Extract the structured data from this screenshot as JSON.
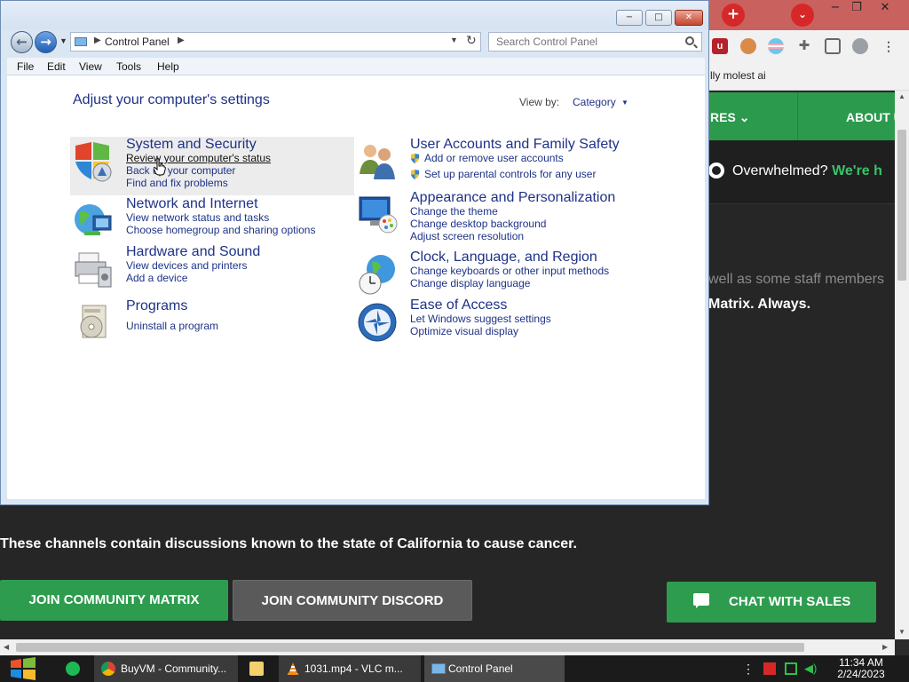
{
  "browser": {
    "title_controls": [
      "−",
      "❐",
      "✕"
    ],
    "bookmark_text": "lly molest ai",
    "nav_res": "RES",
    "nav_about": "ABOUT U",
    "overwhelmed": "Overwhelmed?",
    "overwhelmed_highlight": "We're h",
    "staff_text": "well as some staff members",
    "matrix_always": "Matrix. Always.",
    "cancer_text": "These channels contain discussions known to the state of California to cause cancer.",
    "btn_matrix": "JOIN COMMUNITY MATRIX",
    "btn_discord": "JOIN COMMUNITY DISCORD",
    "btn_sales": "CHAT WITH SALES"
  },
  "window": {
    "min_label": "−",
    "max_label": "□",
    "close_label": "✕",
    "address_text": "Control Panel",
    "search_placeholder": "Search Control Panel",
    "menu": [
      "File",
      "Edit",
      "View",
      "Tools",
      "Help"
    ]
  },
  "content": {
    "heading": "Adjust your computer's settings",
    "view_by_label": "View by:",
    "view_by_value": "Category",
    "categories": [
      {
        "title": "System and Security",
        "links": [
          "Review your computer's status",
          "Back up your computer",
          "Find and fix problems"
        ]
      },
      {
        "title": "Network and Internet",
        "links": [
          "View network status and tasks",
          "Choose homegroup and sharing options"
        ]
      },
      {
        "title": "Hardware and Sound",
        "links": [
          "View devices and printers",
          "Add a device"
        ]
      },
      {
        "title": "Programs",
        "links": [
          "Uninstall a program"
        ]
      },
      {
        "title": "User Accounts and Family Safety",
        "links": [
          "Add or remove user accounts",
          "Set up parental controls for any user"
        ]
      },
      {
        "title": "Appearance and Personalization",
        "links": [
          "Change the theme",
          "Change desktop background",
          "Adjust screen resolution"
        ]
      },
      {
        "title": "Clock, Language, and Region",
        "links": [
          "Change keyboards or other input methods",
          "Change display language"
        ]
      },
      {
        "title": "Ease of Access",
        "links": [
          "Let Windows suggest settings",
          "Optimize visual display"
        ]
      }
    ]
  },
  "taskbar": {
    "chrome": "BuyVM - Community...",
    "vlc": "1031.mp4 - VLC m...",
    "control_panel": "Control Panel",
    "time": "11:34 AM",
    "date": "2/24/2023"
  },
  "colors": {
    "accent_green": "#2e9c4f",
    "link_blue": "#1e3287",
    "window_frame": "#dbe6f3"
  }
}
